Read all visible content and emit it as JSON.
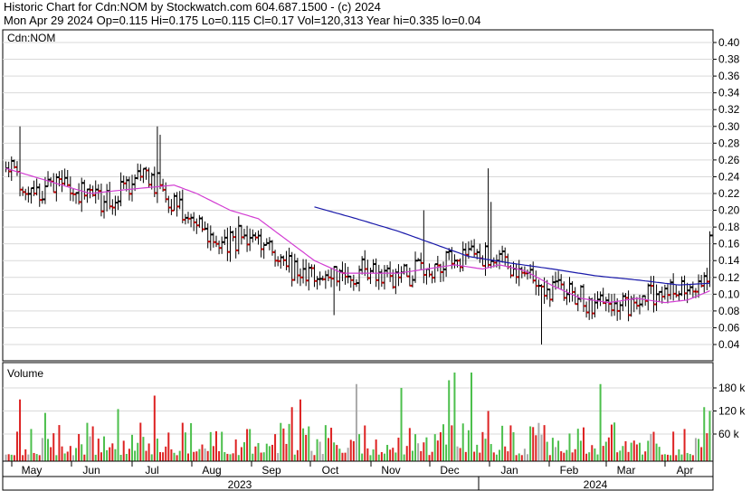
{
  "header": {
    "line1": "Historic Chart for Cdn:NOM by Stockwatch.com 604.687.1500 - (c) 2024",
    "line2": "Mon Apr 29 2024   Op=0.115  Hi=0.175  Lo=0.115  Cl=0.17  Vol=120,313   Year hi=0.335  lo=0.04"
  },
  "colors": {
    "up": "#000000",
    "down": "#cc0000",
    "ma_short": "#d23cd2",
    "ma_long": "#1a1aaa",
    "vol_green": "#4cbf4c",
    "vol_red": "#dd2222",
    "vol_gray": "#aaaaaa",
    "grid": "#d9d9d9"
  },
  "chart_data": [
    {
      "type": "line",
      "title": "Cdn:NOM",
      "subtype": "ohlc_bars",
      "ylim": [
        0.02,
        0.42
      ],
      "y_ticks": [
        "0.40",
        "0.38",
        "0.36",
        "0.34",
        "0.32",
        "0.30",
        "0.28",
        "0.26",
        "0.24",
        "0.22",
        "0.20",
        "0.18",
        "0.16",
        "0.14",
        "0.12",
        "0.10",
        "0.08",
        "0.06",
        "0.04"
      ],
      "y_tick_values": [
        0.4,
        0.38,
        0.36,
        0.34,
        0.32,
        0.3,
        0.28,
        0.26,
        0.24,
        0.22,
        0.2,
        0.18,
        0.16,
        0.14,
        0.12,
        0.1,
        0.08,
        0.06,
        0.04
      ],
      "x_months": [
        "May",
        "Jun",
        "Jul",
        "Aug",
        "Sep",
        "Oct",
        "Nov",
        "Dec",
        "Jan",
        "Feb",
        "Mar",
        "Apr"
      ],
      "x_years": [
        "2023",
        "2024"
      ],
      "bar_count": 252,
      "price_anchors": [
        {
          "i": 0,
          "c": 0.25
        },
        {
          "i": 10,
          "c": 0.22
        },
        {
          "i": 22,
          "c": 0.23
        },
        {
          "i": 35,
          "c": 0.21
        },
        {
          "i": 48,
          "c": 0.24
        },
        {
          "i": 55,
          "c": 0.23
        },
        {
          "i": 65,
          "c": 0.19
        },
        {
          "i": 75,
          "c": 0.16
        },
        {
          "i": 85,
          "c": 0.17
        },
        {
          "i": 95,
          "c": 0.15
        },
        {
          "i": 105,
          "c": 0.12
        },
        {
          "i": 115,
          "c": 0.12
        },
        {
          "i": 128,
          "c": 0.13
        },
        {
          "i": 140,
          "c": 0.12
        },
        {
          "i": 150,
          "c": 0.13
        },
        {
          "i": 160,
          "c": 0.14
        },
        {
          "i": 168,
          "c": 0.15
        },
        {
          "i": 175,
          "c": 0.14
        },
        {
          "i": 183,
          "c": 0.13
        },
        {
          "i": 190,
          "c": 0.11
        },
        {
          "i": 200,
          "c": 0.1
        },
        {
          "i": 210,
          "c": 0.09
        },
        {
          "i": 218,
          "c": 0.08
        },
        {
          "i": 224,
          "c": 0.09
        },
        {
          "i": 232,
          "c": 0.1
        },
        {
          "i": 240,
          "c": 0.1
        },
        {
          "i": 248,
          "c": 0.11
        },
        {
          "i": 250,
          "c": 0.115
        },
        {
          "i": 251,
          "c": 0.17
        }
      ],
      "spikes": [
        {
          "i": 5,
          "h": 0.3
        },
        {
          "i": 54,
          "h": 0.3
        },
        {
          "i": 55,
          "h": 0.29
        },
        {
          "i": 149,
          "h": 0.2
        },
        {
          "i": 172,
          "h": 0.25
        },
        {
          "i": 173,
          "h": 0.21
        },
        {
          "i": 191,
          "l": 0.04
        },
        {
          "i": 117,
          "l": 0.075
        },
        {
          "i": 251,
          "h": 0.175
        }
      ],
      "ma_short": [
        {
          "i": 0,
          "v": 0.25
        },
        {
          "i": 30,
          "v": 0.22
        },
        {
          "i": 44,
          "v": 0.225
        },
        {
          "i": 60,
          "v": 0.23
        },
        {
          "i": 68,
          "v": 0.22
        },
        {
          "i": 80,
          "v": 0.2
        },
        {
          "i": 90,
          "v": 0.19
        },
        {
          "i": 100,
          "v": 0.165
        },
        {
          "i": 110,
          "v": 0.14
        },
        {
          "i": 120,
          "v": 0.125
        },
        {
          "i": 130,
          "v": 0.125
        },
        {
          "i": 140,
          "v": 0.125
        },
        {
          "i": 150,
          "v": 0.13
        },
        {
          "i": 160,
          "v": 0.135
        },
        {
          "i": 170,
          "v": 0.13
        },
        {
          "i": 176,
          "v": 0.135
        },
        {
          "i": 185,
          "v": 0.128
        },
        {
          "i": 195,
          "v": 0.11
        },
        {
          "i": 205,
          "v": 0.095
        },
        {
          "i": 215,
          "v": 0.09
        },
        {
          "i": 225,
          "v": 0.095
        },
        {
          "i": 235,
          "v": 0.09
        },
        {
          "i": 243,
          "v": 0.093
        },
        {
          "i": 251,
          "v": 0.104
        }
      ],
      "ma_long": [
        {
          "i": 110,
          "v": 0.204
        },
        {
          "i": 125,
          "v": 0.19
        },
        {
          "i": 140,
          "v": 0.175
        },
        {
          "i": 150,
          "v": 0.163
        },
        {
          "i": 165,
          "v": 0.145
        },
        {
          "i": 180,
          "v": 0.137
        },
        {
          "i": 195,
          "v": 0.13
        },
        {
          "i": 210,
          "v": 0.122
        },
        {
          "i": 225,
          "v": 0.117
        },
        {
          "i": 240,
          "v": 0.111
        },
        {
          "i": 251,
          "v": 0.113
        }
      ]
    },
    {
      "type": "bar",
      "title": "Volume",
      "ylim": [
        0,
        220000
      ],
      "y_ticks": [
        "180 k",
        "120 k",
        "60 k"
      ],
      "y_tick_values": [
        180000,
        120000,
        60000
      ],
      "note": "daily volume bars; green = up day, red = down day, gray = unchanged",
      "volume_peaks": [
        {
          "i": 5,
          "v": 150000
        },
        {
          "i": 14,
          "v": 115000
        },
        {
          "i": 40,
          "v": 125000
        },
        {
          "i": 53,
          "v": 160000
        },
        {
          "i": 102,
          "v": 130000
        },
        {
          "i": 105,
          "v": 150000
        },
        {
          "i": 125,
          "v": 190000
        },
        {
          "i": 141,
          "v": 180000
        },
        {
          "i": 158,
          "v": 200000
        },
        {
          "i": 160,
          "v": 220000
        },
        {
          "i": 166,
          "v": 220000
        },
        {
          "i": 172,
          "v": 120000
        },
        {
          "i": 212,
          "v": 190000
        },
        {
          "i": 217,
          "v": 90000
        },
        {
          "i": 249,
          "v": 130000
        },
        {
          "i": 251,
          "v": 120000
        }
      ]
    }
  ]
}
